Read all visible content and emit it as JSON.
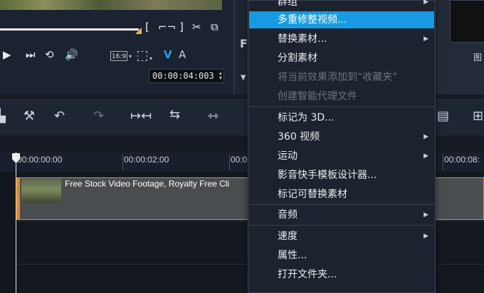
{
  "player": {
    "timecode": "00:00:04:003",
    "aspect_ratio": "16:9",
    "mode_v": "V",
    "mode_a": "A",
    "spin_up": "▲",
    "spin_down": "▼"
  },
  "ruler": {
    "ticks": [
      "00:00:00:00",
      "00:00:02:00",
      "00:0",
      "00:00:08:"
    ]
  },
  "clip": {
    "title": "Free Stock Video Footage, Royalty Free Cli"
  },
  "context_menu": {
    "items": [
      {
        "label": "群组",
        "submenu": true
      },
      {
        "label": "多重修整视频...",
        "highlighted": true
      },
      {
        "label": "替换素材...",
        "submenu": true
      },
      {
        "label": "分割素材"
      },
      {
        "label": "将当前效果添加到“收藏夹”",
        "disabled": true
      },
      {
        "label": "创建智能代理文件",
        "disabled": true
      },
      {
        "label": "标记为 3D..."
      },
      {
        "label": "360 视频",
        "submenu": true
      },
      {
        "label": "运动",
        "submenu": true
      },
      {
        "label": "影音快手模板设计器..."
      },
      {
        "label": "标记可替换素材"
      },
      {
        "label": "音频",
        "submenu": true
      },
      {
        "label": "速度",
        "submenu": true
      },
      {
        "label": "属性..."
      },
      {
        "label": "打开文件夹..."
      }
    ],
    "highlight_color": "#169be2"
  },
  "side_panel": {
    "letter_f": "F",
    "thumb_label": "图"
  }
}
